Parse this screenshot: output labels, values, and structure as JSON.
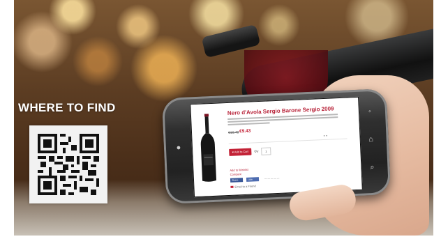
{
  "banner": {
    "headline": "WHERE TO FIND"
  },
  "product": {
    "title": "Nero d'Avola Sergio Barone Sergio 2009",
    "price_old": "€10.48",
    "price_new": "€9.43",
    "add_to_cart": "♥ Add to Cart",
    "qty_label": "Qty",
    "qty_value": "1",
    "wishlist": "Add to Wishlist",
    "compare": "Compare",
    "share_a": "Share",
    "share_b": "Like",
    "email": "Email to a Friend"
  },
  "phone_buttons": {
    "back": "◦",
    "home": "⌂",
    "search": "⌕"
  },
  "colors": {
    "accent": "#c32236",
    "title": "#b8243a"
  }
}
